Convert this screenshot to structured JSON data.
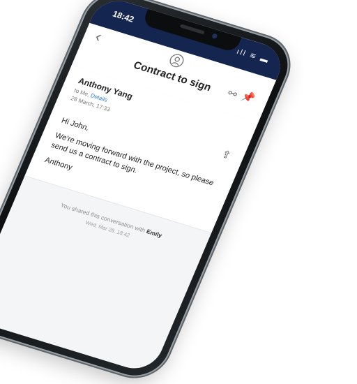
{
  "status": {
    "time": "18:42",
    "signal_icons": "ıll ≋ ▬"
  },
  "nav": {
    "title": "Contract to sign"
  },
  "message": {
    "sender": "Anthony Yang",
    "to_prefix": "to Me, ",
    "details_link": "Details",
    "date": "28 March, 17:33",
    "body": {
      "greeting": "Hi John,",
      "paragraph": "We're moving forward with the project, so please send us a contract to sign.",
      "signoff": "Anthony"
    }
  },
  "shared": {
    "prefix": "You shared this conversation with ",
    "name": "Emily",
    "date": "Wed, Mar 28, 18:42"
  }
}
